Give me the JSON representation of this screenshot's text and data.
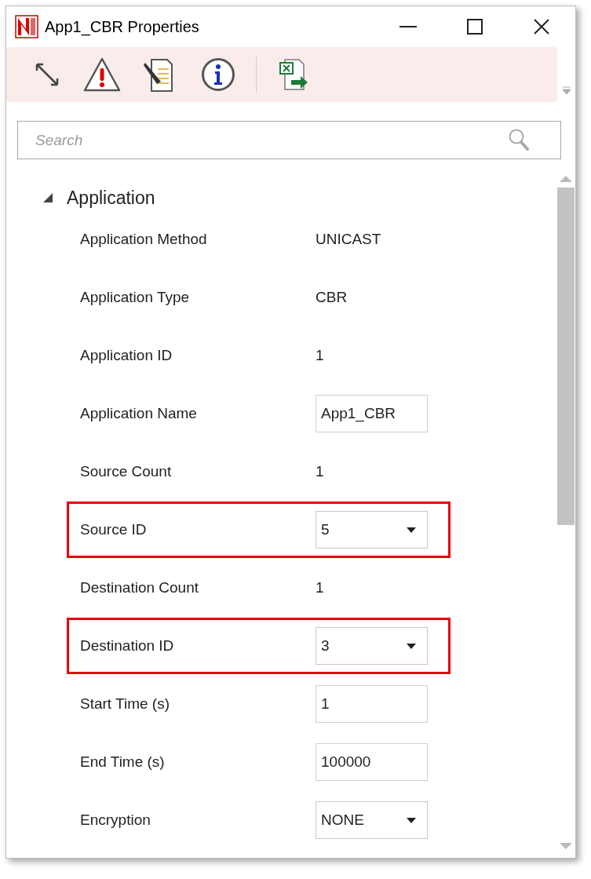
{
  "window": {
    "title": "App1_CBR Properties"
  },
  "search": {
    "placeholder": "Search"
  },
  "section": {
    "title": "Application",
    "expanded": true,
    "rows": [
      {
        "label": "Application Method",
        "kind": "text",
        "value": "UNICAST",
        "highlighted": false
      },
      {
        "label": "Application Type",
        "kind": "text",
        "value": "CBR",
        "highlighted": false
      },
      {
        "label": "Application ID",
        "kind": "text",
        "value": "1",
        "highlighted": false
      },
      {
        "label": "Application Name",
        "kind": "input",
        "value": "App1_CBR",
        "highlighted": false
      },
      {
        "label": "Source Count",
        "kind": "text",
        "value": "1",
        "highlighted": false
      },
      {
        "label": "Source ID",
        "kind": "dropdown",
        "value": "5",
        "highlighted": true
      },
      {
        "label": "Destination Count",
        "kind": "text",
        "value": "1",
        "highlighted": false
      },
      {
        "label": "Destination ID",
        "kind": "dropdown",
        "value": "3",
        "highlighted": true
      },
      {
        "label": "Start Time (s)",
        "kind": "input",
        "value": "1",
        "highlighted": false
      },
      {
        "label": "End Time (s)",
        "kind": "input",
        "value": "100000",
        "highlighted": false
      },
      {
        "label": "Encryption",
        "kind": "dropdown",
        "value": "NONE",
        "highlighted": false
      }
    ]
  }
}
